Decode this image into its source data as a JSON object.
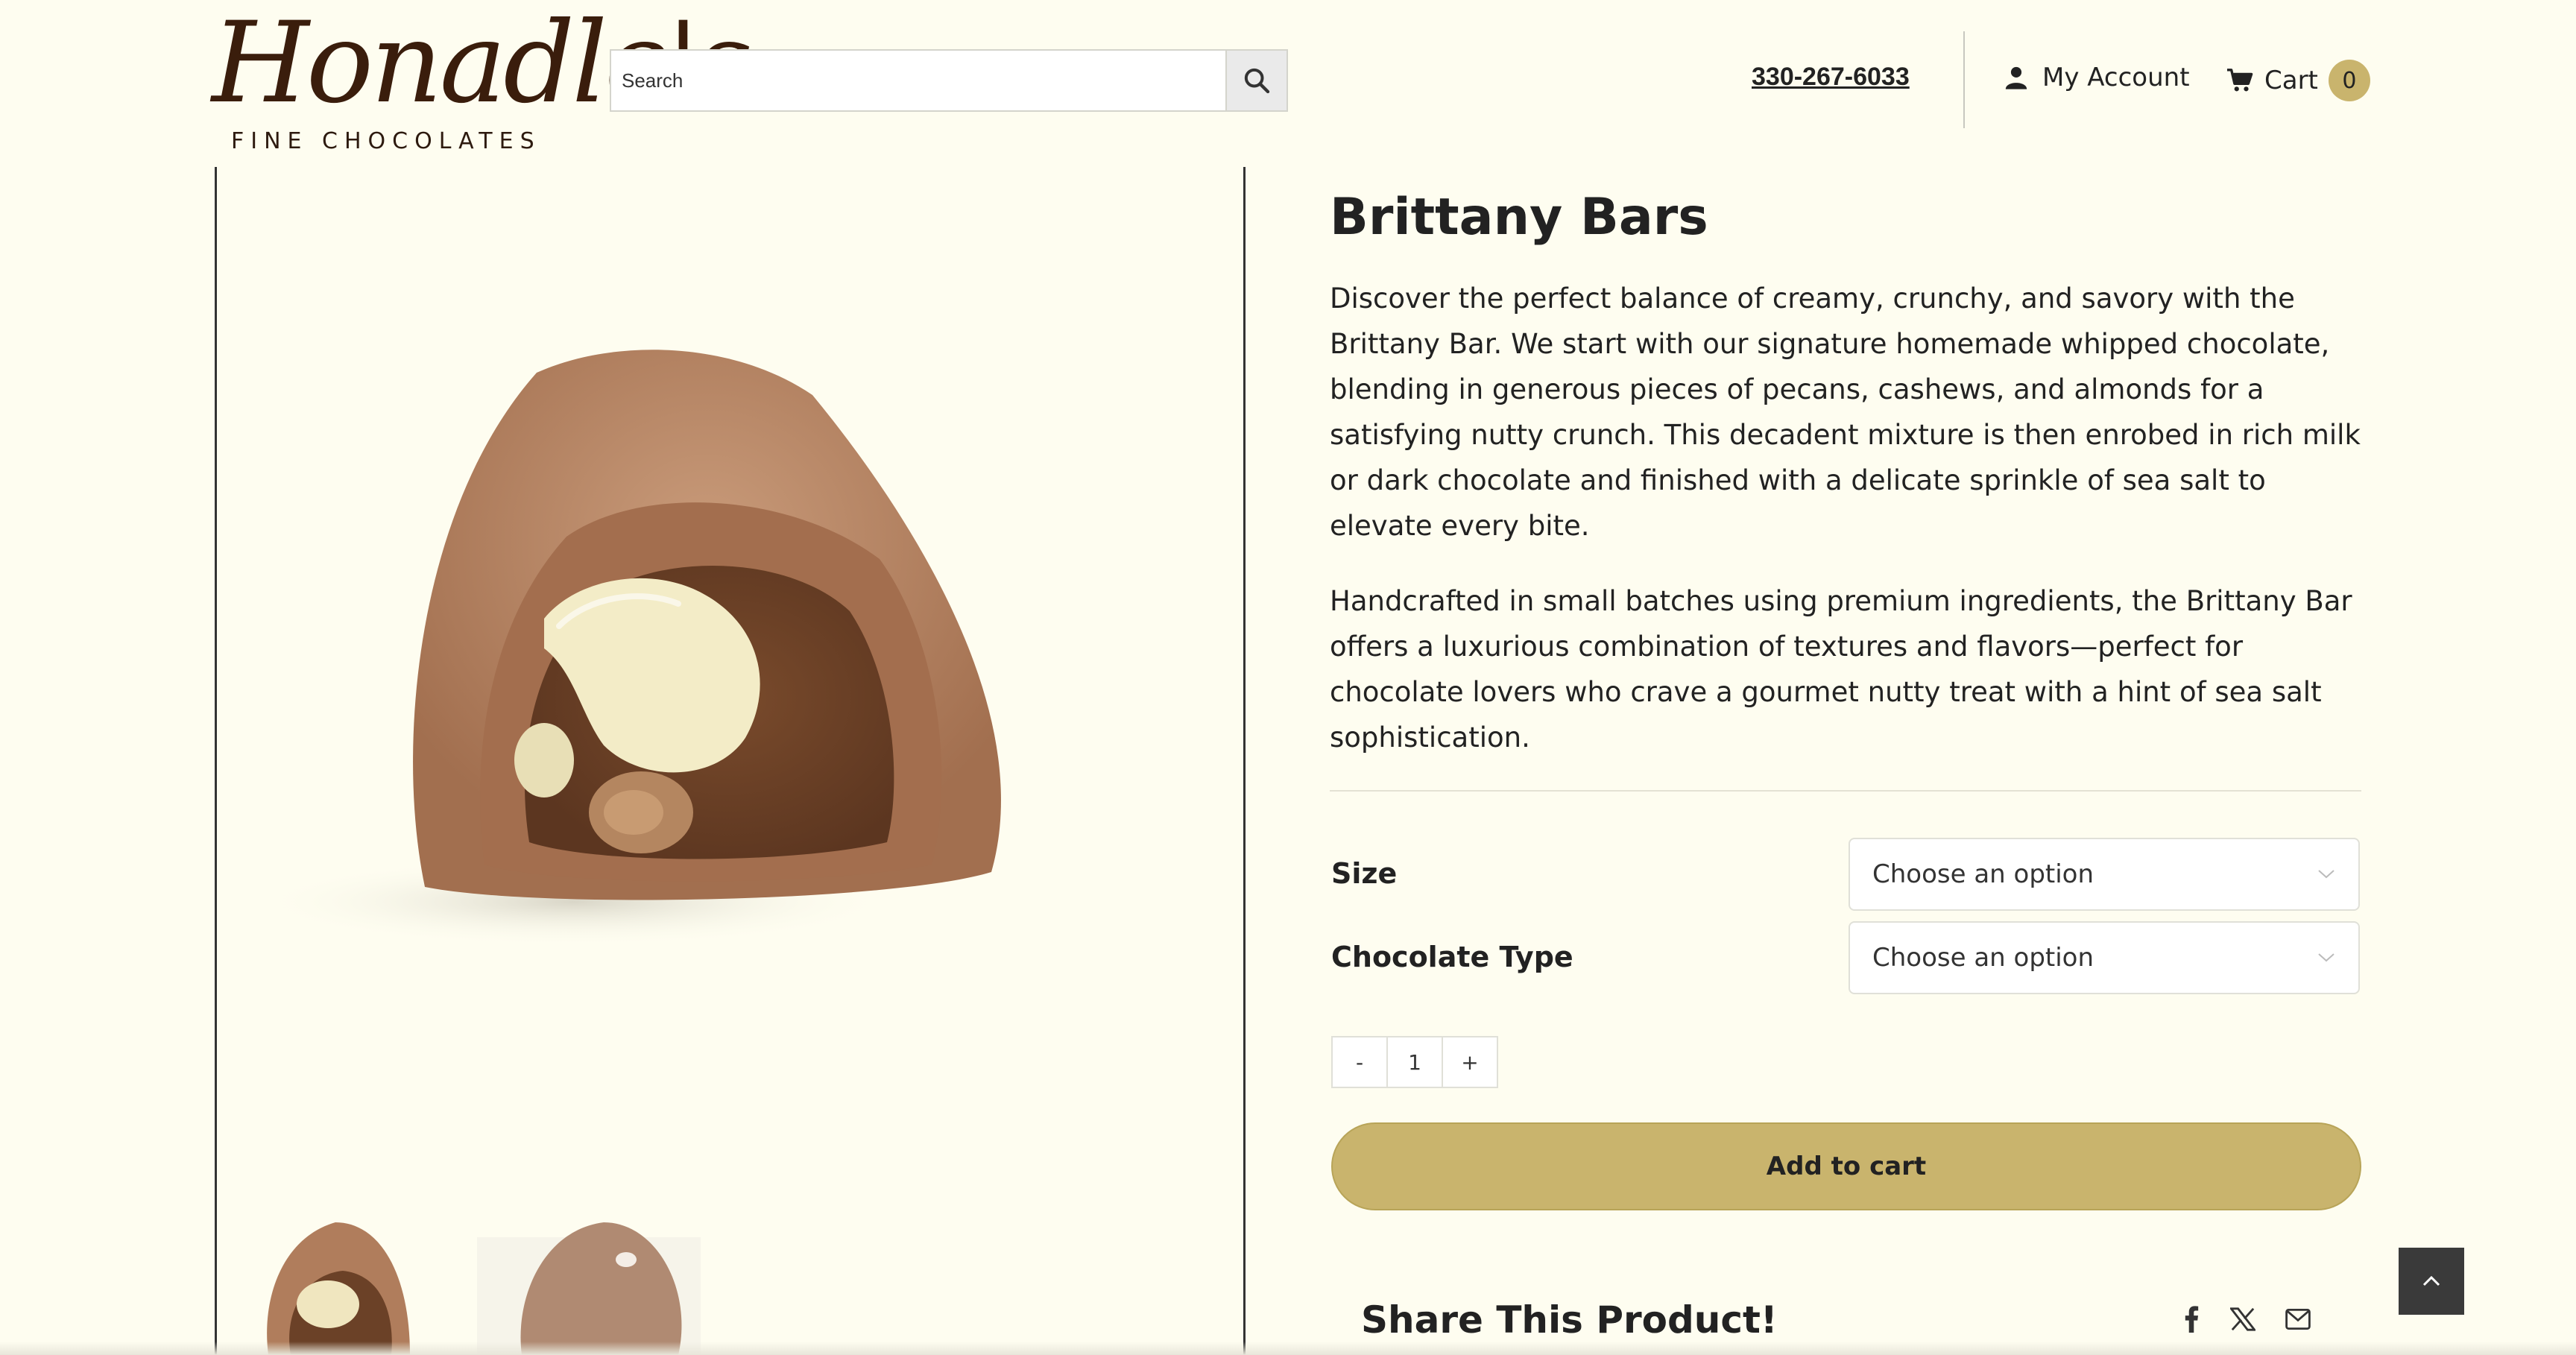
{
  "header": {
    "logo_script": "Honadle's",
    "logo_sub": "FINE CHOCOLATES",
    "search_placeholder": "Search",
    "phone": "330-267-6033",
    "account_label": "My Account",
    "cart_label": "Cart",
    "cart_count": "0"
  },
  "product": {
    "title": "Brittany Bars",
    "description_1": "Discover the perfect balance of creamy, crunchy, and savory with the Brittany Bar. We start with our signature homemade whipped chocolate, blending in generous pieces of pecans, cashews, and almonds for a satisfying nutty crunch. This decadent mixture is then enrobed in rich milk or dark chocolate and finished with a delicate sprinkle of sea salt to elevate every bite.",
    "description_2": "Handcrafted in small batches using premium ingredients, the Brittany Bar offers a luxurious combination of textures and flavors—perfect for chocolate lovers who crave a gourmet nutty treat with a hint of sea salt sophistication.",
    "options": [
      {
        "label": "Size",
        "value": "Choose an option"
      },
      {
        "label": "Chocolate Type",
        "value": "Choose an option"
      }
    ],
    "quantity": {
      "minus": "-",
      "value": "1",
      "plus": "+"
    },
    "add_to_cart": "Add to cart",
    "share_title": "Share This Product!"
  },
  "colors": {
    "background": "#fefdf0",
    "accent_gold": "#c9b46d",
    "logo_brown": "#3a1d0c"
  },
  "icons": [
    "search-icon",
    "user-icon",
    "cart-icon",
    "chevron-down-icon",
    "facebook-icon",
    "x-icon",
    "mail-icon",
    "chevron-up-icon"
  ]
}
